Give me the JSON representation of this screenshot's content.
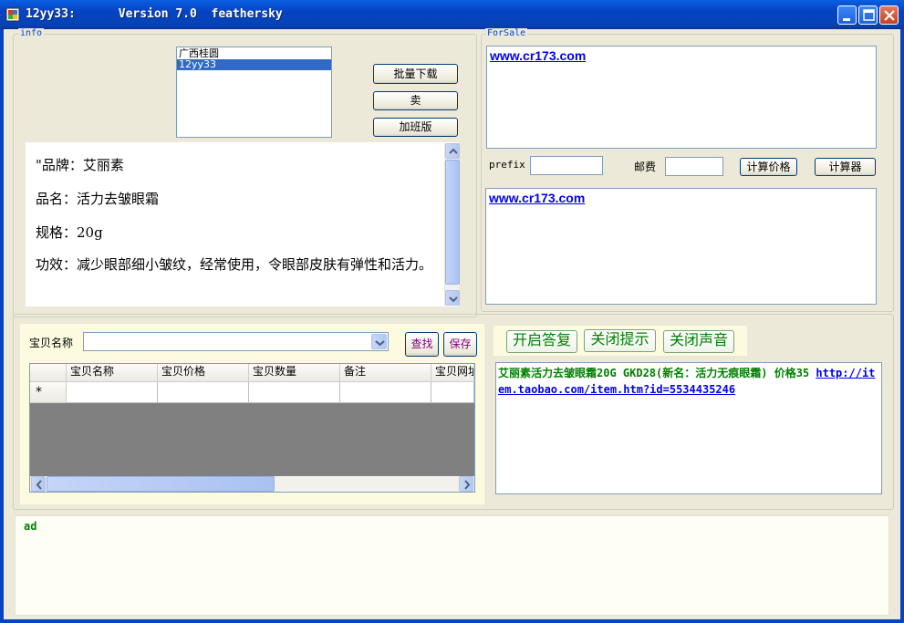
{
  "window": {
    "title": "12yy33:      Version 7.0  feathersky",
    "minimize": "minimize",
    "maximize": "maximize",
    "close": "close"
  },
  "info": {
    "legend": "info",
    "list_items": [
      "广西桂圆",
      "12yy33"
    ],
    "selected_index": 1,
    "buttons": {
      "batch_download": "批量下载",
      "sell": "卖",
      "overtime": "加班版"
    },
    "detail_lines": [
      "\"品牌：艾丽素",
      "品名：活力去皱眼霜",
      "规格：20g",
      "功效：减少眼部细小皱纹，经常使用，令眼部皮肤有弹性和活力。"
    ]
  },
  "forsale": {
    "legend": "ForSale",
    "top_link": "www.cr173.com",
    "prefix_label": "prefix",
    "prefix_value": "",
    "postage_label": "邮费",
    "postage_value": "",
    "calc_price_button": "计算价格",
    "calculator_button": "计算器",
    "bottom_link": "www.cr173.com"
  },
  "search": {
    "label": "宝贝名称",
    "combo_value": "",
    "find_button": "查找",
    "save_button": "保存",
    "columns": [
      "宝贝名称",
      "宝贝价格",
      "宝贝数量",
      "备注",
      "宝贝网址"
    ],
    "new_row_marker": "*"
  },
  "chat": {
    "buttons": {
      "open_reply": "开启答复",
      "close_tip": "关闭提示",
      "close_sound": "关闭声音"
    },
    "message_text": "艾丽素活力去皱眼霜20G GKD28(新名：活力无痕眼霜) 价格35  ",
    "message_link": "http://item.taobao.com/item.htm?id=5534435246"
  },
  "ad": {
    "label": "ad"
  },
  "colors": {
    "titlebar": "#0543c4",
    "legend_text": "#0046d5",
    "chat_green": "#008000",
    "selection": "#316ac5"
  }
}
